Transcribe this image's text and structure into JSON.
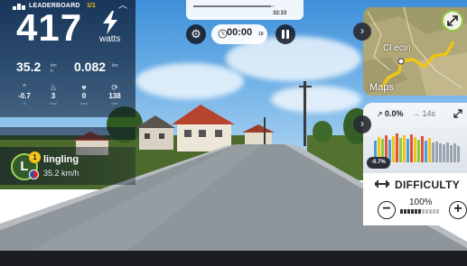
{
  "ride": {
    "power_value": "417",
    "power_unit": "watts",
    "speed_value": "35.2",
    "speed_unit_top": "km",
    "speed_unit_bottom": "h",
    "distance_value": "0.082",
    "distance_unit": "km",
    "metrics": [
      {
        "icon": "elevation-icon",
        "value": "-0.7",
        "label": "%"
      },
      {
        "icon": "flame-icon",
        "value": "3",
        "label": "kcal"
      },
      {
        "icon": "heart-icon",
        "value": "0",
        "label": "bpm"
      },
      {
        "icon": "cadence-icon",
        "value": "138",
        "label": "rpm"
      }
    ]
  },
  "leaderboard": {
    "title": "LEADERBOARD",
    "count": "1/1",
    "rider": {
      "initial": "L",
      "rank": "1",
      "name": "lingling",
      "speed": "35.2 km/h"
    }
  },
  "timer": {
    "progress_label": "32:33",
    "progress_fraction": 0.95,
    "elapsed_main": "00:00",
    "elapsed_small": "18"
  },
  "map": {
    "place_label": "Cl ecin",
    "brand": "Maps"
  },
  "elevation": {
    "current_grade": "0.0%",
    "next_grade": "14s",
    "pill_grade": "-0.7%"
  },
  "difficulty": {
    "title": "DIFFICULTY",
    "percent": "100%",
    "minus_label": "−",
    "plus_label": "+"
  },
  "colors": {
    "accent_green": "#8fc93a",
    "rank_gold": "#f5c518",
    "panel_dark": "#0a1428"
  }
}
